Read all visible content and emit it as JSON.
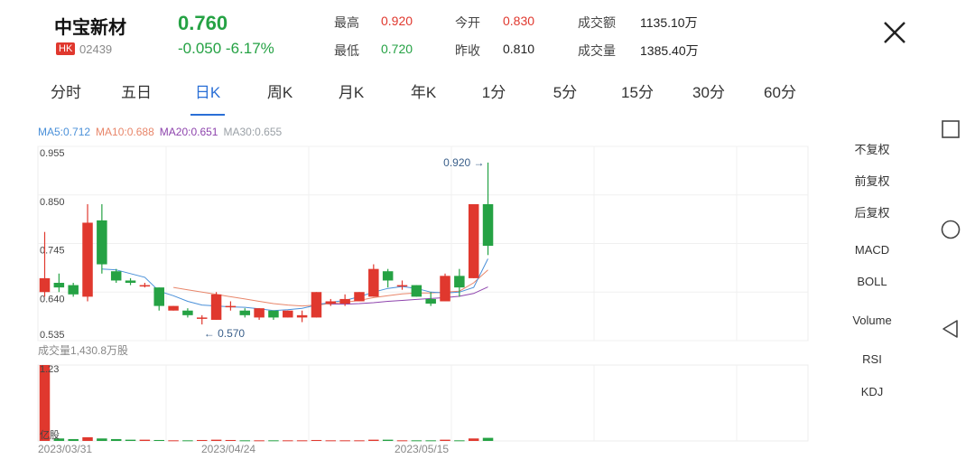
{
  "header": {
    "name": "中宝新材",
    "badge": "HK",
    "code": "02439",
    "price": "0.760",
    "change": "-0.050 -6.17%",
    "stats": [
      {
        "label": "最高",
        "value": "0.920",
        "tone": "red"
      },
      {
        "label": "今开",
        "value": "0.830",
        "tone": "red"
      },
      {
        "label": "成交额",
        "value": "1135.10万",
        "tone": "dark"
      },
      {
        "label": "最低",
        "value": "0.720",
        "tone": "green"
      },
      {
        "label": "昨收",
        "value": "0.810",
        "tone": "dark"
      },
      {
        "label": "成交量",
        "value": "1385.40万",
        "tone": "dark"
      }
    ]
  },
  "tabs": [
    {
      "label": "分时"
    },
    {
      "label": "五日"
    },
    {
      "label": "日K",
      "active": true
    },
    {
      "label": "周K"
    },
    {
      "label": "月K"
    },
    {
      "label": "年K"
    },
    {
      "label": "1分"
    },
    {
      "label": "5分"
    },
    {
      "label": "15分"
    },
    {
      "label": "30分"
    },
    {
      "label": "60分"
    }
  ],
  "ma": [
    {
      "label": "MA5:0.712",
      "color": "#4a90d9"
    },
    {
      "label": "MA10:0.688",
      "color": "#e8866a"
    },
    {
      "label": "MA20:0.651",
      "color": "#8e44ad"
    },
    {
      "label": "MA30:0.655",
      "color": "#9aa0a6"
    }
  ],
  "side_menu": [
    {
      "label": "不复权",
      "active": true
    },
    {
      "label": "前复权"
    },
    {
      "label": "后复权"
    },
    {
      "label": "MACD"
    },
    {
      "label": "BOLL"
    },
    {
      "label": "Volume",
      "active": true
    },
    {
      "label": "RSI"
    },
    {
      "label": "KDJ"
    }
  ],
  "chart_data": {
    "type": "candlestick",
    "price_axis": {
      "ticks": [
        "0.955",
        "0.850",
        "0.745",
        "0.640",
        "0.535"
      ],
      "ylim": [
        0.535,
        0.955
      ]
    },
    "annotations": {
      "high": "0.920 →",
      "low": "← 0.570"
    },
    "volume_label": "成交量1,430.8万股",
    "volume_axis": {
      "max_label": "1.23",
      "unit_label": "亿股",
      "ylim": [
        0,
        1.23
      ]
    },
    "date_labels": [
      "2023/03/31",
      "2023/04/24",
      "2023/05/15"
    ],
    "candles": [
      {
        "o": 0.64,
        "h": 0.77,
        "l": 0.63,
        "c": 0.67
      },
      {
        "o": 0.66,
        "h": 0.68,
        "l": 0.64,
        "c": 0.65
      },
      {
        "o": 0.655,
        "h": 0.66,
        "l": 0.63,
        "c": 0.635
      },
      {
        "o": 0.63,
        "h": 0.83,
        "l": 0.62,
        "c": 0.79
      },
      {
        "o": 0.795,
        "h": 0.83,
        "l": 0.68,
        "c": 0.7
      },
      {
        "o": 0.685,
        "h": 0.69,
        "l": 0.66,
        "c": 0.665
      },
      {
        "o": 0.665,
        "h": 0.67,
        "l": 0.655,
        "c": 0.66
      },
      {
        "o": 0.655,
        "h": 0.66,
        "l": 0.65,
        "c": 0.655
      },
      {
        "o": 0.65,
        "h": 0.65,
        "l": 0.6,
        "c": 0.61
      },
      {
        "o": 0.6,
        "h": 0.61,
        "l": 0.6,
        "c": 0.61
      },
      {
        "o": 0.6,
        "h": 0.605,
        "l": 0.585,
        "c": 0.59
      },
      {
        "o": 0.585,
        "h": 0.59,
        "l": 0.57,
        "c": 0.585
      },
      {
        "o": 0.58,
        "h": 0.64,
        "l": 0.58,
        "c": 0.635
      },
      {
        "o": 0.61,
        "h": 0.62,
        "l": 0.6,
        "c": 0.61
      },
      {
        "o": 0.6,
        "h": 0.605,
        "l": 0.585,
        "c": 0.59
      },
      {
        "o": 0.585,
        "h": 0.605,
        "l": 0.58,
        "c": 0.605
      },
      {
        "o": 0.6,
        "h": 0.6,
        "l": 0.58,
        "c": 0.585
      },
      {
        "o": 0.585,
        "h": 0.6,
        "l": 0.585,
        "c": 0.6
      },
      {
        "o": 0.585,
        "h": 0.6,
        "l": 0.575,
        "c": 0.59
      },
      {
        "o": 0.585,
        "h": 0.64,
        "l": 0.585,
        "c": 0.64
      },
      {
        "o": 0.615,
        "h": 0.625,
        "l": 0.61,
        "c": 0.62
      },
      {
        "o": 0.615,
        "h": 0.635,
        "l": 0.61,
        "c": 0.625
      },
      {
        "o": 0.62,
        "h": 0.64,
        "l": 0.62,
        "c": 0.64
      },
      {
        "o": 0.63,
        "h": 0.7,
        "l": 0.63,
        "c": 0.69
      },
      {
        "o": 0.685,
        "h": 0.69,
        "l": 0.65,
        "c": 0.665
      },
      {
        "o": 0.655,
        "h": 0.665,
        "l": 0.645,
        "c": 0.655
      },
      {
        "o": 0.655,
        "h": 0.655,
        "l": 0.63,
        "c": 0.63
      },
      {
        "o": 0.625,
        "h": 0.64,
        "l": 0.61,
        "c": 0.615
      },
      {
        "o": 0.62,
        "h": 0.68,
        "l": 0.62,
        "c": 0.675
      },
      {
        "o": 0.675,
        "h": 0.69,
        "l": 0.63,
        "c": 0.65
      },
      {
        "o": 0.67,
        "h": 0.83,
        "l": 0.67,
        "c": 0.83
      },
      {
        "o": 0.83,
        "h": 0.92,
        "l": 0.72,
        "c": 0.74
      }
    ],
    "volumes": [
      1.23,
      0.04,
      0.03,
      0.06,
      0.04,
      0.03,
      0.02,
      0.02,
      0.015,
      0.01,
      0.01,
      0.015,
      0.02,
      0.015,
      0.01,
      0.01,
      0.01,
      0.01,
      0.01,
      0.015,
      0.01,
      0.01,
      0.01,
      0.02,
      0.02,
      0.01,
      0.01,
      0.01,
      0.02,
      0.01,
      0.04,
      0.05
    ],
    "ma_series": {
      "ma5": [
        null,
        null,
        null,
        null,
        0.69,
        0.688,
        0.68,
        0.672,
        0.642,
        0.632,
        0.62,
        0.612,
        0.61,
        0.608,
        0.607,
        0.604,
        0.6,
        0.602,
        0.605,
        0.612,
        0.618,
        0.622,
        0.63,
        0.64,
        0.648,
        0.652,
        0.648,
        0.64,
        0.638,
        0.64,
        0.65,
        0.712
      ],
      "ma10": [
        null,
        null,
        null,
        null,
        null,
        null,
        null,
        null,
        null,
        0.65,
        0.645,
        0.64,
        0.635,
        0.63,
        0.625,
        0.62,
        0.615,
        0.612,
        0.61,
        0.612,
        0.615,
        0.618,
        0.622,
        0.628,
        0.632,
        0.636,
        0.638,
        0.638,
        0.64,
        0.642,
        0.66,
        0.688
      ],
      "ma20": [
        null,
        null,
        null,
        null,
        null,
        null,
        null,
        null,
        null,
        null,
        null,
        null,
        null,
        null,
        null,
        null,
        null,
        null,
        null,
        0.615,
        0.614,
        0.614,
        0.615,
        0.617,
        0.62,
        0.622,
        0.624,
        0.626,
        0.628,
        0.631,
        0.637,
        0.651
      ]
    },
    "colors": {
      "up": "#e0382e",
      "down": "#25a244",
      "ma5": "#4a90d9",
      "ma10": "#e8866a",
      "ma20": "#8e44ad"
    }
  }
}
